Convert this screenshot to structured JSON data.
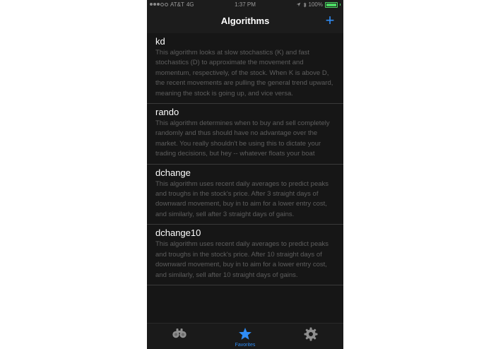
{
  "status_bar": {
    "carrier": "AT&T",
    "network": "4G",
    "time": "1:37 PM",
    "battery": "100%",
    "battery_level": 1.0
  },
  "nav": {
    "title": "Algorithms",
    "add_label": "+"
  },
  "algorithms": [
    {
      "name": "kd",
      "description": "This algorithm looks at slow stochastics (K) and fast stochastics (D) to approximate the movement and momentum, respectively, of the stock. When K is above D, the recent movements are pulling the general trend upward, meaning the stock is going up, and vice versa."
    },
    {
      "name": "rando",
      "description": "This algorithm determines when to buy and sell completely randomly and thus should have no advantage over the market. You really shouldn't be using this to dictate your trading decisions, but hey -- whatever floats your boat"
    },
    {
      "name": "dchange",
      "description": "This algorithm uses recent daily averages to predict peaks and troughs in the stock's price. After 3 straight days of downward movement, buy in to aim for a lower entry cost, and similarly, sell after 3 straight days of gains."
    },
    {
      "name": "dchange10",
      "description": "This algorithm uses recent daily averages to predict peaks and troughs in the stock's price. After 10 straight days of downward movement, buy in to aim for a lower entry cost, and similarly, sell after 10 straight days of gains."
    }
  ],
  "tabs": [
    {
      "icon": "binoculars-icon",
      "label": ""
    },
    {
      "icon": "star-icon",
      "label": "Favorites",
      "active": true
    },
    {
      "icon": "gear-icon",
      "label": ""
    }
  ],
  "colors": {
    "accent": "#2f8cf5",
    "background": "#161616",
    "battery": "#4cd964",
    "description_text": "#5e5e5e"
  }
}
